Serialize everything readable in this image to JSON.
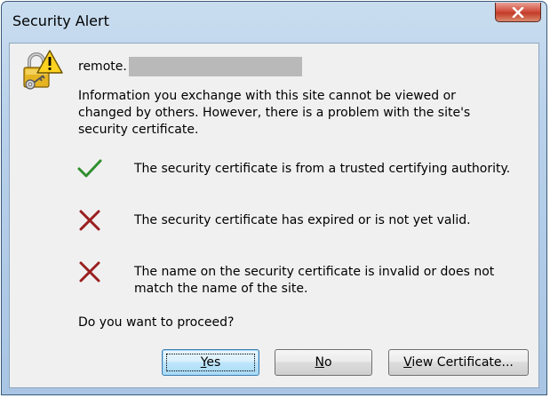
{
  "window": {
    "title": "Security Alert"
  },
  "header": {
    "host_prefix": "remote."
  },
  "info_text": "Information you exchange with this site cannot be viewed or changed by others. However, there is a problem with the site's security certificate.",
  "checks": [
    {
      "status": "pass",
      "icon": "green-check-icon",
      "text": "The security certificate is from a trusted certifying authority."
    },
    {
      "status": "fail",
      "icon": "red-x-icon",
      "text": "The security certificate has expired or is not yet valid."
    },
    {
      "status": "fail",
      "icon": "red-x-icon",
      "text": "The name on the security certificate is invalid or does not match the name of the site."
    }
  ],
  "question": "Do you want to proceed?",
  "buttons": {
    "yes": "Yes",
    "no": "No",
    "view_certificate": "View Certificate..."
  },
  "colors": {
    "pass": "#2f8f2f",
    "fail": "#9a1f1f",
    "close_button": "#c43a28"
  }
}
